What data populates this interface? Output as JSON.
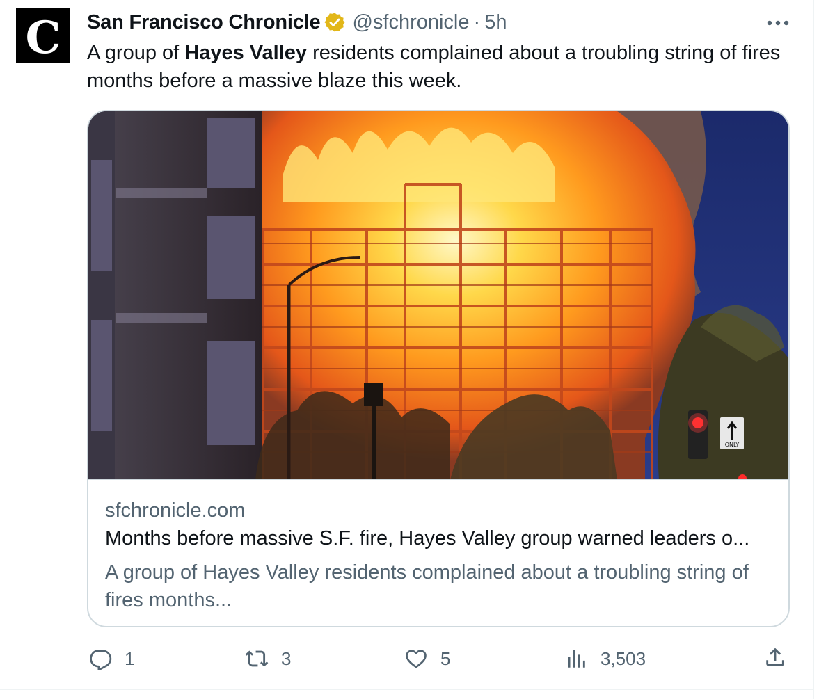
{
  "tweet": {
    "author_name": "San Francisco Chronicle",
    "handle": "@sfchronicle",
    "separator": "·",
    "time": "5h",
    "text_before": "A group of ",
    "text_bold": "Hayes Valley",
    "text_after": " residents complained about a troubling string of fires months before a massive blaze this week.",
    "avatar_letter": "C"
  },
  "card": {
    "domain": "sfchronicle.com",
    "title": "Months before massive S.F. fire, Hayes Valley group warned leaders o...",
    "description": "A group of Hayes Valley residents complained about a troubling string of fires months...",
    "sign_text": "ONLY"
  },
  "actions": {
    "replies": "1",
    "retweets": "3",
    "likes": "5",
    "views": "3,503"
  },
  "colors": {
    "text_primary": "#0f1419",
    "text_secondary": "#536471",
    "border": "#cfd9de",
    "verified_gold": "#e2b719"
  },
  "icons": {
    "more": "more-icon",
    "reply": "reply-icon",
    "retweet": "retweet-icon",
    "like": "heart-icon",
    "views": "analytics-icon",
    "share": "share-icon",
    "verified": "verified-badge-icon"
  }
}
